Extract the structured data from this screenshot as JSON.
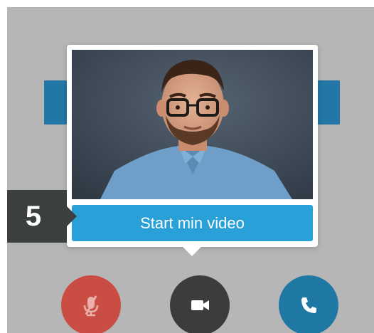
{
  "step": {
    "number": "5"
  },
  "popup": {
    "button_label": "Start min video"
  },
  "controls": [
    {
      "name": "mute",
      "icon": "mic-off-icon",
      "color": "#c94d43"
    },
    {
      "name": "video",
      "icon": "video-camera-icon",
      "color": "#3c3c3c"
    },
    {
      "name": "call",
      "icon": "phone-icon",
      "color": "#1f78a4"
    }
  ],
  "colors": {
    "backdrop": "#b6b6b6",
    "accent": "#2aa0d8",
    "badge": "#3b3f40"
  }
}
